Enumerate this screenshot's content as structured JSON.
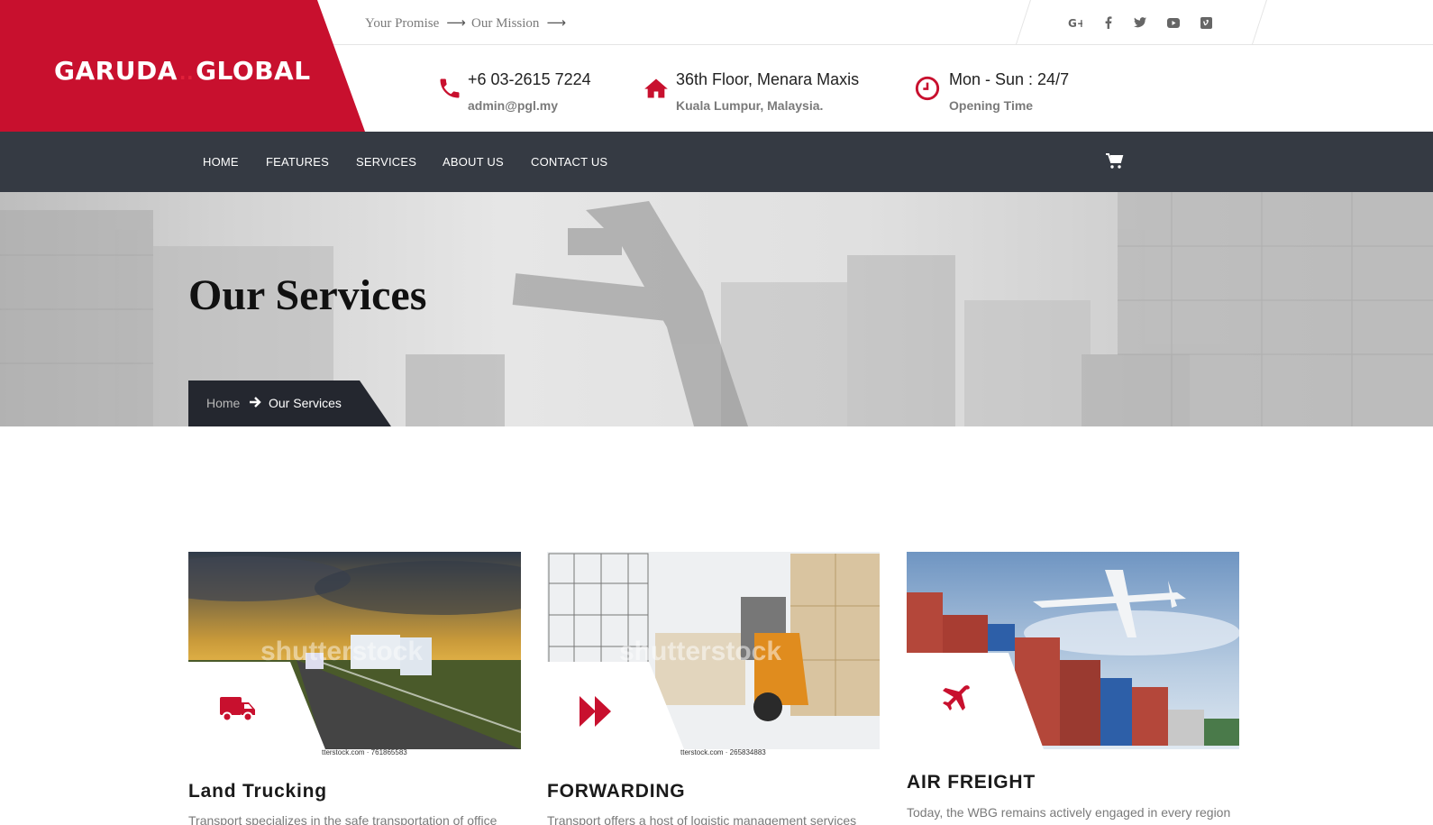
{
  "brand": {
    "name_left": "GARUDA",
    "dots": "..",
    "name_right": "GLOBAL"
  },
  "topbar": {
    "links": [
      {
        "label": "Your Promise",
        "arrow": "⟶"
      },
      {
        "label": "Our Mission",
        "arrow": "⟶"
      }
    ],
    "social": [
      "google-plus-icon",
      "facebook-icon",
      "twitter-icon",
      "youtube-icon",
      "vimeo-icon"
    ]
  },
  "contact": {
    "phone": {
      "main": "+6 03-2615 7224",
      "sub": "admin@pgl.my",
      "icon": "phone-icon"
    },
    "address": {
      "main": "36th Floor, Menara Maxis",
      "sub": "Kuala Lumpur, Malaysia.",
      "icon": "home-icon"
    },
    "hours": {
      "main": "Mon - Sun : 24/7",
      "sub": "Opening Time",
      "icon": "clock-icon"
    }
  },
  "nav": {
    "items": [
      "HOME",
      "FEATURES",
      "SERVICES",
      "ABOUT US",
      "CONTACT US"
    ],
    "cart_icon": "cart-icon"
  },
  "hero": {
    "title": "Our Services",
    "breadcrumb": {
      "home": "Home",
      "current": "Our Services"
    }
  },
  "services": [
    {
      "title": "Land Trucking",
      "text": "Transport specializes in the safe transportation of office",
      "icon": "truck-icon",
      "watermark": "shutterstock",
      "credit": "tterstock.com · 761865583"
    },
    {
      "title": "FORWARDING",
      "text": "Transport offers a host of logistic management services",
      "icon": "fast-forward-icon",
      "watermark": "shutterstock",
      "credit": "tterstock.com · 265834883"
    },
    {
      "title": "AIR FREIGHT",
      "text": "Today, the WBG remains actively engaged in every region",
      "icon": "plane-icon"
    }
  ],
  "colors": {
    "brand_red": "#c8102e",
    "nav_bg": "#353a43",
    "breadcrumb_bg": "#24272f"
  }
}
